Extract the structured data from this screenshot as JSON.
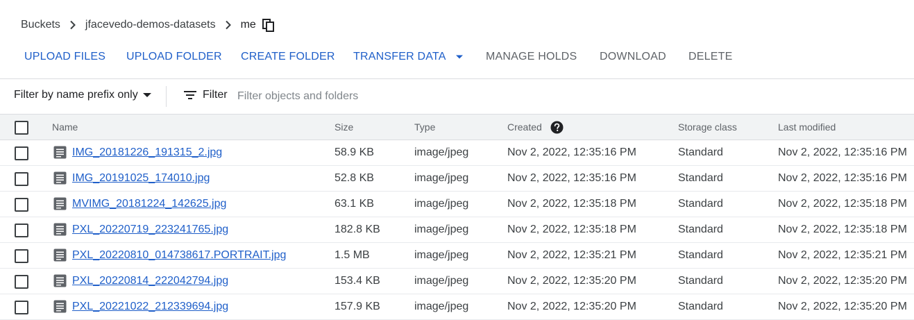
{
  "breadcrumb": {
    "items": [
      "Buckets",
      "jfacevedo-demos-datasets"
    ],
    "current": "me"
  },
  "toolbar": {
    "upload_files": "UPLOAD FILES",
    "upload_folder": "UPLOAD FOLDER",
    "create_folder": "CREATE FOLDER",
    "transfer_data": "TRANSFER DATA",
    "manage_holds": "MANAGE HOLDS",
    "download": "DOWNLOAD",
    "delete": "DELETE"
  },
  "filter": {
    "prefix_select": "Filter by name prefix only",
    "filter_label": "Filter",
    "placeholder": "Filter objects and folders",
    "value": ""
  },
  "table": {
    "headers": {
      "name": "Name",
      "size": "Size",
      "type": "Type",
      "created": "Created",
      "storage_class": "Storage class",
      "last_modified": "Last modified"
    },
    "rows": [
      {
        "name": "IMG_20181226_191315_2.jpg",
        "size": "58.9 KB",
        "type": "image/jpeg",
        "created": "Nov 2, 2022, 12:35:16 PM",
        "storage_class": "Standard",
        "last_modified": "Nov 2, 2022, 12:35:16 PM"
      },
      {
        "name": "IMG_20191025_174010.jpg",
        "size": "52.8 KB",
        "type": "image/jpeg",
        "created": "Nov 2, 2022, 12:35:16 PM",
        "storage_class": "Standard",
        "last_modified": "Nov 2, 2022, 12:35:16 PM"
      },
      {
        "name": "MVIMG_20181224_142625.jpg",
        "size": "63.1 KB",
        "type": "image/jpeg",
        "created": "Nov 2, 2022, 12:35:18 PM",
        "storage_class": "Standard",
        "last_modified": "Nov 2, 2022, 12:35:18 PM"
      },
      {
        "name": "PXL_20220719_223241765.jpg",
        "size": "182.8 KB",
        "type": "image/jpeg",
        "created": "Nov 2, 2022, 12:35:18 PM",
        "storage_class": "Standard",
        "last_modified": "Nov 2, 2022, 12:35:18 PM"
      },
      {
        "name": "PXL_20220810_014738617.PORTRAIT.jpg",
        "size": "1.5 MB",
        "type": "image/jpeg",
        "created": "Nov 2, 2022, 12:35:21 PM",
        "storage_class": "Standard",
        "last_modified": "Nov 2, 2022, 12:35:21 PM"
      },
      {
        "name": "PXL_20220814_222042794.jpg",
        "size": "153.4 KB",
        "type": "image/jpeg",
        "created": "Nov 2, 2022, 12:35:20 PM",
        "storage_class": "Standard",
        "last_modified": "Nov 2, 2022, 12:35:20 PM"
      },
      {
        "name": "PXL_20221022_212339694.jpg",
        "size": "157.9 KB",
        "type": "image/jpeg",
        "created": "Nov 2, 2022, 12:35:20 PM",
        "storage_class": "Standard",
        "last_modified": "Nov 2, 2022, 12:35:20 PM"
      }
    ]
  },
  "icons": {
    "breadcrumb_separator": "chevron-right-icon",
    "copy": "copy-icon",
    "dropdown": "caret-down-icon",
    "filter": "filter-icon",
    "help": "help-icon",
    "file": "file-icon"
  },
  "colors": {
    "accent": "#1f5fc9",
    "disabled": "#5f6368",
    "header_bg": "#f1f3f4"
  }
}
